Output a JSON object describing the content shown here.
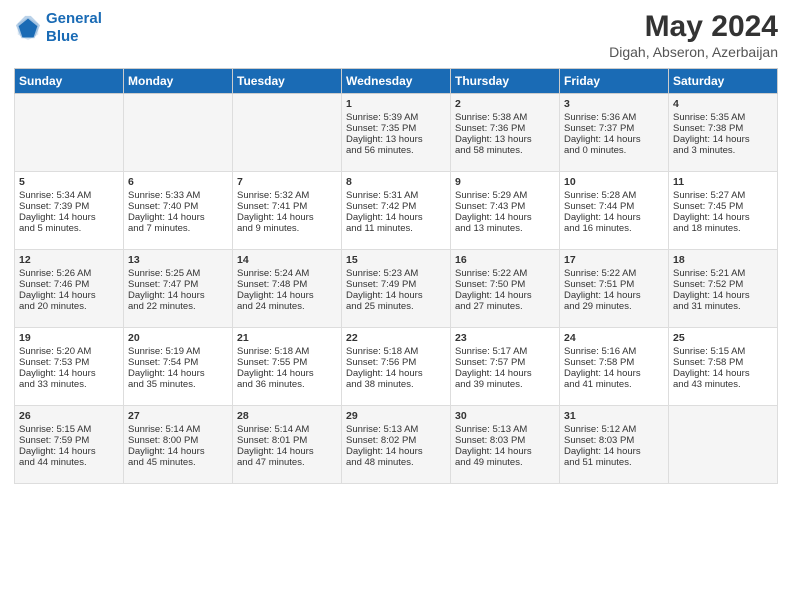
{
  "header": {
    "logo_line1": "General",
    "logo_line2": "Blue",
    "main_title": "May 2024",
    "subtitle": "Digah, Abseron, Azerbaijan"
  },
  "days_of_week": [
    "Sunday",
    "Monday",
    "Tuesday",
    "Wednesday",
    "Thursday",
    "Friday",
    "Saturday"
  ],
  "weeks": [
    {
      "cells": [
        {
          "day": "",
          "content": ""
        },
        {
          "day": "",
          "content": ""
        },
        {
          "day": "",
          "content": ""
        },
        {
          "day": "1",
          "content": "Sunrise: 5:39 AM\nSunset: 7:35 PM\nDaylight: 13 hours\nand 56 minutes."
        },
        {
          "day": "2",
          "content": "Sunrise: 5:38 AM\nSunset: 7:36 PM\nDaylight: 13 hours\nand 58 minutes."
        },
        {
          "day": "3",
          "content": "Sunrise: 5:36 AM\nSunset: 7:37 PM\nDaylight: 14 hours\nand 0 minutes."
        },
        {
          "day": "4",
          "content": "Sunrise: 5:35 AM\nSunset: 7:38 PM\nDaylight: 14 hours\nand 3 minutes."
        }
      ]
    },
    {
      "cells": [
        {
          "day": "5",
          "content": "Sunrise: 5:34 AM\nSunset: 7:39 PM\nDaylight: 14 hours\nand 5 minutes."
        },
        {
          "day": "6",
          "content": "Sunrise: 5:33 AM\nSunset: 7:40 PM\nDaylight: 14 hours\nand 7 minutes."
        },
        {
          "day": "7",
          "content": "Sunrise: 5:32 AM\nSunset: 7:41 PM\nDaylight: 14 hours\nand 9 minutes."
        },
        {
          "day": "8",
          "content": "Sunrise: 5:31 AM\nSunset: 7:42 PM\nDaylight: 14 hours\nand 11 minutes."
        },
        {
          "day": "9",
          "content": "Sunrise: 5:29 AM\nSunset: 7:43 PM\nDaylight: 14 hours\nand 13 minutes."
        },
        {
          "day": "10",
          "content": "Sunrise: 5:28 AM\nSunset: 7:44 PM\nDaylight: 14 hours\nand 16 minutes."
        },
        {
          "day": "11",
          "content": "Sunrise: 5:27 AM\nSunset: 7:45 PM\nDaylight: 14 hours\nand 18 minutes."
        }
      ]
    },
    {
      "cells": [
        {
          "day": "12",
          "content": "Sunrise: 5:26 AM\nSunset: 7:46 PM\nDaylight: 14 hours\nand 20 minutes."
        },
        {
          "day": "13",
          "content": "Sunrise: 5:25 AM\nSunset: 7:47 PM\nDaylight: 14 hours\nand 22 minutes."
        },
        {
          "day": "14",
          "content": "Sunrise: 5:24 AM\nSunset: 7:48 PM\nDaylight: 14 hours\nand 24 minutes."
        },
        {
          "day": "15",
          "content": "Sunrise: 5:23 AM\nSunset: 7:49 PM\nDaylight: 14 hours\nand 25 minutes."
        },
        {
          "day": "16",
          "content": "Sunrise: 5:22 AM\nSunset: 7:50 PM\nDaylight: 14 hours\nand 27 minutes."
        },
        {
          "day": "17",
          "content": "Sunrise: 5:22 AM\nSunset: 7:51 PM\nDaylight: 14 hours\nand 29 minutes."
        },
        {
          "day": "18",
          "content": "Sunrise: 5:21 AM\nSunset: 7:52 PM\nDaylight: 14 hours\nand 31 minutes."
        }
      ]
    },
    {
      "cells": [
        {
          "day": "19",
          "content": "Sunrise: 5:20 AM\nSunset: 7:53 PM\nDaylight: 14 hours\nand 33 minutes."
        },
        {
          "day": "20",
          "content": "Sunrise: 5:19 AM\nSunset: 7:54 PM\nDaylight: 14 hours\nand 35 minutes."
        },
        {
          "day": "21",
          "content": "Sunrise: 5:18 AM\nSunset: 7:55 PM\nDaylight: 14 hours\nand 36 minutes."
        },
        {
          "day": "22",
          "content": "Sunrise: 5:18 AM\nSunset: 7:56 PM\nDaylight: 14 hours\nand 38 minutes."
        },
        {
          "day": "23",
          "content": "Sunrise: 5:17 AM\nSunset: 7:57 PM\nDaylight: 14 hours\nand 39 minutes."
        },
        {
          "day": "24",
          "content": "Sunrise: 5:16 AM\nSunset: 7:58 PM\nDaylight: 14 hours\nand 41 minutes."
        },
        {
          "day": "25",
          "content": "Sunrise: 5:15 AM\nSunset: 7:58 PM\nDaylight: 14 hours\nand 43 minutes."
        }
      ]
    },
    {
      "cells": [
        {
          "day": "26",
          "content": "Sunrise: 5:15 AM\nSunset: 7:59 PM\nDaylight: 14 hours\nand 44 minutes."
        },
        {
          "day": "27",
          "content": "Sunrise: 5:14 AM\nSunset: 8:00 PM\nDaylight: 14 hours\nand 45 minutes."
        },
        {
          "day": "28",
          "content": "Sunrise: 5:14 AM\nSunset: 8:01 PM\nDaylight: 14 hours\nand 47 minutes."
        },
        {
          "day": "29",
          "content": "Sunrise: 5:13 AM\nSunset: 8:02 PM\nDaylight: 14 hours\nand 48 minutes."
        },
        {
          "day": "30",
          "content": "Sunrise: 5:13 AM\nSunset: 8:03 PM\nDaylight: 14 hours\nand 49 minutes."
        },
        {
          "day": "31",
          "content": "Sunrise: 5:12 AM\nSunset: 8:03 PM\nDaylight: 14 hours\nand 51 minutes."
        },
        {
          "day": "",
          "content": ""
        }
      ]
    }
  ]
}
